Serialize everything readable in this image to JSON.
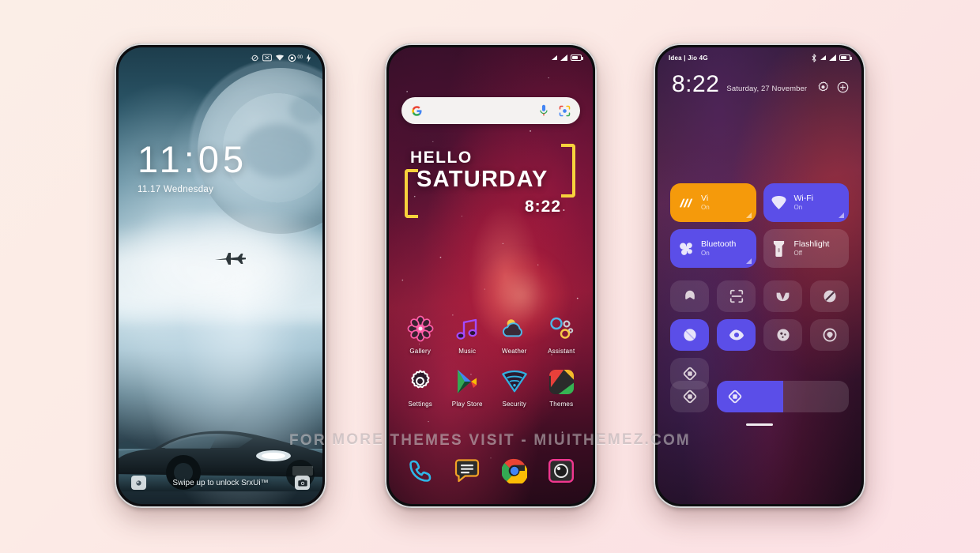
{
  "background": {
    "color_start": "#fbeee7",
    "color_end": "#fce1e6"
  },
  "watermark": {
    "text": "FOR MORE THEMES VISIT - MIUITHEMEZ.COM"
  },
  "lock_screen": {
    "statusbar": {
      "icons": [
        "dnd-icon",
        "no-sim-icon",
        "wifi-icon",
        "dual-sim-icon",
        "charging-bolt-icon"
      ]
    },
    "time": "11:05",
    "date": "11.17 Wednesday",
    "hint": "Swipe up to unlock SrxUi™",
    "left_shortcut": "flashlight-icon",
    "right_shortcut": "camera-icon"
  },
  "home_screen": {
    "statusbar": {
      "icons": [
        "signal-bar-icon",
        "signal-bar-icon",
        "battery-icon"
      ]
    },
    "search": {
      "placeholder": "",
      "google_icon": "google-g-icon",
      "mic_icon": "microphone-icon",
      "lens_icon": "google-lens-icon"
    },
    "greeting": {
      "line1": "HELLO",
      "line2": "SATURDAY",
      "time": "8:22",
      "bracket_color": "#f7d23c"
    },
    "apps": [
      {
        "label": "Gallery",
        "icon": "flower-gallery-icon"
      },
      {
        "label": "Music",
        "icon": "music-note-icon"
      },
      {
        "label": "Weather",
        "icon": "cloud-sun-icon"
      },
      {
        "label": "Assistant",
        "icon": "assistant-dots-icon"
      },
      {
        "label": "Settings",
        "icon": "gear-icon"
      },
      {
        "label": "Play Store",
        "icon": "play-store-icon"
      },
      {
        "label": "Security",
        "icon": "security-shield-icon"
      },
      {
        "label": "Themes",
        "icon": "themes-icon"
      }
    ],
    "dock": [
      {
        "label": "Phone",
        "icon": "phone-handset-icon"
      },
      {
        "label": "Messages",
        "icon": "messages-icon"
      },
      {
        "label": "Chrome",
        "icon": "chrome-icon"
      },
      {
        "label": "Camera",
        "icon": "camera-icon"
      }
    ]
  },
  "control_center": {
    "statusbar": {
      "carrier": "Idea | Jio 4G",
      "icons": [
        "bluetooth-icon",
        "signal-bar-icon",
        "signal-bar-icon",
        "battery-icon"
      ]
    },
    "time": "8:22",
    "date": "Saturday, 27 November",
    "header_buttons": [
      "settings-gear-icon",
      "add-edit-icon"
    ],
    "big_tiles": [
      {
        "name": "Vi",
        "state": "On",
        "icon": "vi-network-icon",
        "color": "#f59a0b",
        "active": true
      },
      {
        "name": "Wi-Fi",
        "state": "On",
        "icon": "wifi-icon",
        "color": "#5b4ee8",
        "active": true
      },
      {
        "name": "Bluetooth",
        "state": "On",
        "icon": "bluetooth-icon",
        "color": "#5b4ee8",
        "active": true
      },
      {
        "name": "Flashlight",
        "state": "Off",
        "icon": "flashlight-icon",
        "color": "rgba(255,255,255,0.13)",
        "active": false
      }
    ],
    "small_tiles": [
      {
        "icon": "airplane-mode-icon",
        "active": false
      },
      {
        "icon": "scan-qr-icon",
        "active": false
      },
      {
        "icon": "vibrate-icon",
        "active": false
      },
      {
        "icon": "dnd-icon",
        "active": false
      },
      {
        "icon": "screenshot-icon",
        "active": true
      },
      {
        "icon": "eye-care-icon",
        "active": true
      },
      {
        "icon": "screen-record-icon",
        "active": false
      },
      {
        "icon": "location-icon",
        "active": false
      },
      {
        "icon": "auto-rotate-icon",
        "active": false
      }
    ],
    "brightness_slider": {
      "icon": "brightness-icon",
      "value_percent": 50
    },
    "handle": "drag-handle"
  }
}
